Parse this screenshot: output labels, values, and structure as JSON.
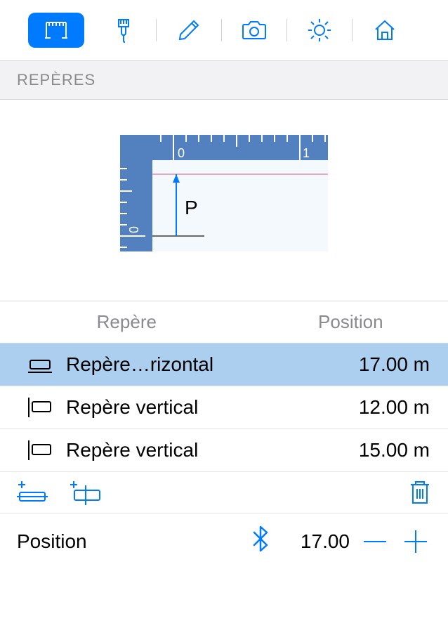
{
  "toolbar": {
    "tools": [
      "measure",
      "brush",
      "pencil",
      "camera",
      "sun",
      "home"
    ],
    "activeIndex": 0
  },
  "section": {
    "title": "REPÈRES"
  },
  "preview": {
    "letter": "P",
    "topTicks": [
      "0",
      "1"
    ],
    "leftTick": "0"
  },
  "table": {
    "headers": {
      "repere": "Repère",
      "position": "Position"
    },
    "rows": [
      {
        "type": "horizontal",
        "label": "Repère…rizontal",
        "value": "17.00 m",
        "selected": true
      },
      {
        "type": "vertical",
        "label": "Repère vertical",
        "value": "12.00 m",
        "selected": false
      },
      {
        "type": "vertical",
        "label": "Repère vertical",
        "value": "15.00 m",
        "selected": false
      }
    ]
  },
  "actions": {
    "addH": "add-horizontal",
    "addV": "add-vertical",
    "delete": "delete"
  },
  "editor": {
    "label": "Position",
    "value": "17.00"
  }
}
